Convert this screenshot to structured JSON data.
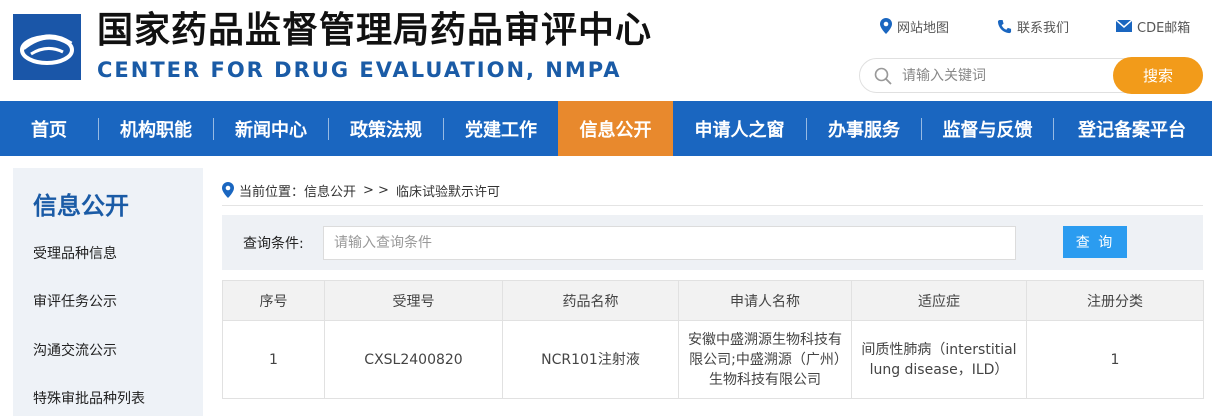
{
  "header": {
    "title_cn": "国家药品监督管理局药品审评中心",
    "title_en": "CENTER FOR DRUG EVALUATION, NMPA",
    "top_links": [
      {
        "label": "网站地图",
        "icon": "map-pin-icon"
      },
      {
        "label": "联系我们",
        "icon": "phone-icon"
      },
      {
        "label": "CDE邮箱",
        "icon": "mail-icon"
      }
    ],
    "search": {
      "placeholder": "请输入关键词",
      "button_label": "搜索"
    }
  },
  "nav": {
    "items": [
      {
        "label": "首页"
      },
      {
        "label": "机构职能"
      },
      {
        "label": "新闻中心"
      },
      {
        "label": "政策法规"
      },
      {
        "label": "党建工作"
      },
      {
        "label": "信息公开"
      },
      {
        "label": "申请人之窗"
      },
      {
        "label": "办事服务"
      },
      {
        "label": "监督与反馈"
      },
      {
        "label": "登记备案平台"
      }
    ],
    "active": "信息公开"
  },
  "sidebar": {
    "title": "信息公开",
    "items": [
      {
        "label": "受理品种信息"
      },
      {
        "label": "审评任务公示"
      },
      {
        "label": "沟通交流公示"
      },
      {
        "label": "特殊审批品种列表"
      }
    ]
  },
  "breadcrumb": {
    "prefix": "当前位置：",
    "level1": "信息公开",
    "sep": "> >",
    "level2": "临床试验默示许可"
  },
  "query": {
    "label": "查询条件:",
    "placeholder": "请输入查询条件",
    "button_label": "查 询"
  },
  "table": {
    "columns": [
      "序号",
      "受理号",
      "药品名称",
      "申请人名称",
      "适应症",
      "注册分类"
    ],
    "rows": [
      {
        "index": "1",
        "acceptance_no": "CXSL2400820",
        "drug_name": "NCR101注射液",
        "applicant": "安徽中盛溯源生物科技有限公司;中盛溯源（广州）生物科技有限公司",
        "indication": "间质性肺病（interstitial lung disease，ILD）",
        "category": "1"
      }
    ]
  },
  "colors": {
    "brand_blue": "#1a66c0",
    "active_orange": "#e8892d",
    "search_orange": "#f29b1a",
    "query_blue": "#2b9cf0"
  }
}
